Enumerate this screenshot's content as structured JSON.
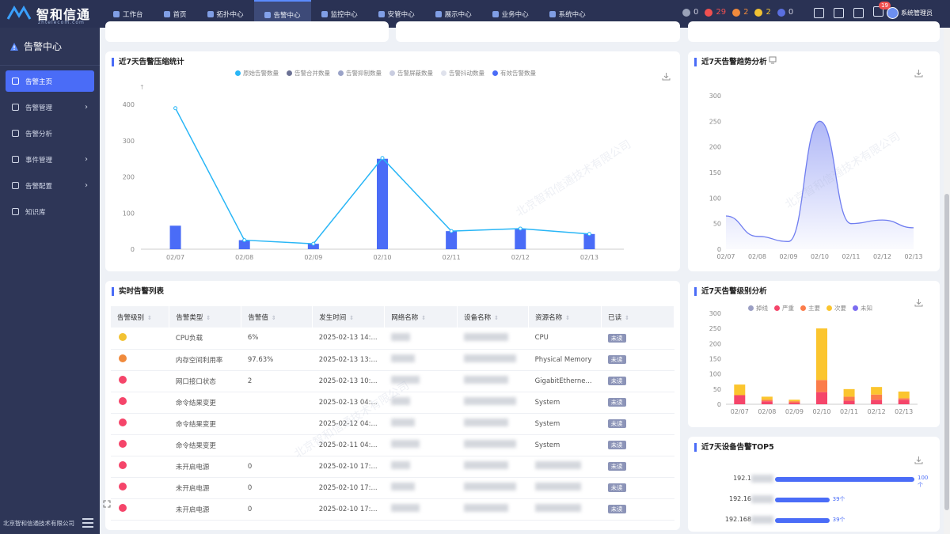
{
  "brand": {
    "name": "智和信通",
    "sub": "zhtelecom.com"
  },
  "nav": [
    {
      "label": "工作台",
      "active": false
    },
    {
      "label": "首页",
      "active": false
    },
    {
      "label": "拓扑中心",
      "active": false
    },
    {
      "label": "告警中心",
      "active": true
    },
    {
      "label": "监控中心",
      "active": false
    },
    {
      "label": "安管中心",
      "active": false
    },
    {
      "label": "展示中心",
      "active": false
    },
    {
      "label": "业务中心",
      "active": false
    },
    {
      "label": "系统中心",
      "active": false
    }
  ],
  "status": [
    {
      "count": "0",
      "color": "#9aa2b8"
    },
    {
      "count": "29",
      "color": "#f05050"
    },
    {
      "count": "2",
      "color": "#f08a3c"
    },
    {
      "count": "2",
      "color": "#f2c233"
    },
    {
      "count": "0",
      "color": "#5a6fe0"
    }
  ],
  "notifications": "19",
  "user": "系统管理员",
  "sidebar": {
    "title": "告警中心",
    "items": [
      {
        "label": "告警主页",
        "active": true,
        "has_children": false
      },
      {
        "label": "告警管理",
        "active": false,
        "has_children": true
      },
      {
        "label": "告警分析",
        "active": false,
        "has_children": false
      },
      {
        "label": "事件管理",
        "active": false,
        "has_children": true
      },
      {
        "label": "告警配置",
        "active": false,
        "has_children": true
      },
      {
        "label": "知识库",
        "active": false,
        "has_children": false
      }
    ],
    "footer": "北京智和信通技术有限公司"
  },
  "compression": {
    "title": "近7天告警压缩统计",
    "legend": [
      "原始告警数量",
      "告警合并数量",
      "告警抑制数量",
      "告警屏蔽数量",
      "告警抖动数量",
      "有效告警数量"
    ],
    "legend_colors": [
      "#29b6f6",
      "#6b7194",
      "#9aa3c8",
      "#c9cde0",
      "#dfe2ec",
      "#4a6cf7"
    ]
  },
  "trend": {
    "title": "近7天告警趋势分析"
  },
  "level": {
    "title": "近7天告警级别分析",
    "legend": [
      "掉线",
      "严重",
      "主要",
      "次要",
      "未知"
    ],
    "legend_colors": [
      "#9b9fc4",
      "#f5456a",
      "#fb7c4a",
      "#fbc52e",
      "#7b6cf0"
    ]
  },
  "top5": {
    "title": "近7天设备告警TOP5",
    "rows": [
      {
        "ip": "192.1",
        "count": "100个",
        "value": 100
      },
      {
        "ip": "192.16",
        "count": "39个",
        "value": 39
      },
      {
        "ip": "192.168",
        "count": "39个",
        "value": 39
      }
    ]
  },
  "alarm_table": {
    "title": "实时告警列表",
    "columns": [
      "告警级别",
      "告警类型",
      "告警值",
      "发生时间",
      "网络名称",
      "设备名称",
      "资源名称",
      "已读"
    ],
    "rows": [
      {
        "level": "#f2c233",
        "type": "CPU负载",
        "value": "6%",
        "time": "2025-02-13 14:...",
        "resource": "CPU",
        "read": "未读"
      },
      {
        "level": "#f08a3c",
        "type": "内存空间利用率",
        "value": "97.63%",
        "time": "2025-02-13 13:...",
        "resource": "Physical Memory",
        "read": "未读"
      },
      {
        "level": "#f5456a",
        "type": "网口接口状态",
        "value": "2",
        "time": "2025-02-13 10:...",
        "resource": "GigabitEtherne...",
        "read": "未读"
      },
      {
        "level": "#f5456a",
        "type": "命令结果变更",
        "value": "",
        "time": "2025-02-13 04:...",
        "resource": "System",
        "read": "未读"
      },
      {
        "level": "#f5456a",
        "type": "命令结果变更",
        "value": "",
        "time": "2025-02-12 04:...",
        "resource": "System",
        "read": "未读"
      },
      {
        "level": "#f5456a",
        "type": "命令结果变更",
        "value": "",
        "time": "2025-02-11 04:...",
        "resource": "System",
        "read": "未读"
      },
      {
        "level": "#f5456a",
        "type": "未开启电源",
        "value": "0",
        "time": "2025-02-10 17:...",
        "resource": "",
        "read": "未读"
      },
      {
        "level": "#f5456a",
        "type": "未开启电源",
        "value": "0",
        "time": "2025-02-10 17:...",
        "resource": "",
        "read": "未读"
      },
      {
        "level": "#f5456a",
        "type": "未开启电源",
        "value": "0",
        "time": "2025-02-10 17:...",
        "resource": "",
        "read": "未读"
      }
    ]
  },
  "chart_data": [
    {
      "type": "bar",
      "title": "近7天告警压缩统计",
      "categories": [
        "02/07",
        "02/08",
        "02/09",
        "02/10",
        "02/11",
        "02/12",
        "02/13"
      ],
      "series": [
        {
          "name": "原始告警数量",
          "kind": "line",
          "values": [
            390,
            25,
            15,
            252,
            50,
            57,
            42
          ]
        },
        {
          "name": "有效告警数量",
          "kind": "bar",
          "values": [
            65,
            25,
            15,
            250,
            50,
            57,
            42
          ]
        }
      ],
      "yticks": [
        0,
        100,
        200,
        300,
        400
      ],
      "ylim": [
        0,
        420
      ]
    },
    {
      "type": "area",
      "title": "近7天告警趋势分析",
      "categories": [
        "02/07",
        "02/08",
        "02/09",
        "02/10",
        "02/11",
        "02/12",
        "02/13"
      ],
      "values": [
        65,
        25,
        15,
        250,
        50,
        57,
        42
      ],
      "yticks": [
        0,
        50,
        100,
        150,
        200,
        250,
        300
      ],
      "ylim": [
        0,
        300
      ]
    },
    {
      "type": "bar",
      "title": "近7天告警级别分析",
      "stacked": true,
      "categories": [
        "02/07",
        "02/08",
        "02/09",
        "02/10",
        "02/11",
        "02/12",
        "02/13"
      ],
      "series": [
        {
          "name": "严重",
          "values": [
            30,
            10,
            5,
            40,
            12,
            15,
            15
          ]
        },
        {
          "name": "主要",
          "values": [
            0,
            5,
            5,
            40,
            13,
            17,
            5
          ]
        },
        {
          "name": "次要",
          "values": [
            35,
            10,
            5,
            170,
            25,
            25,
            22
          ]
        }
      ],
      "yticks": [
        0,
        50,
        100,
        150,
        200,
        250,
        300
      ],
      "ylim": [
        0,
        300
      ]
    }
  ]
}
